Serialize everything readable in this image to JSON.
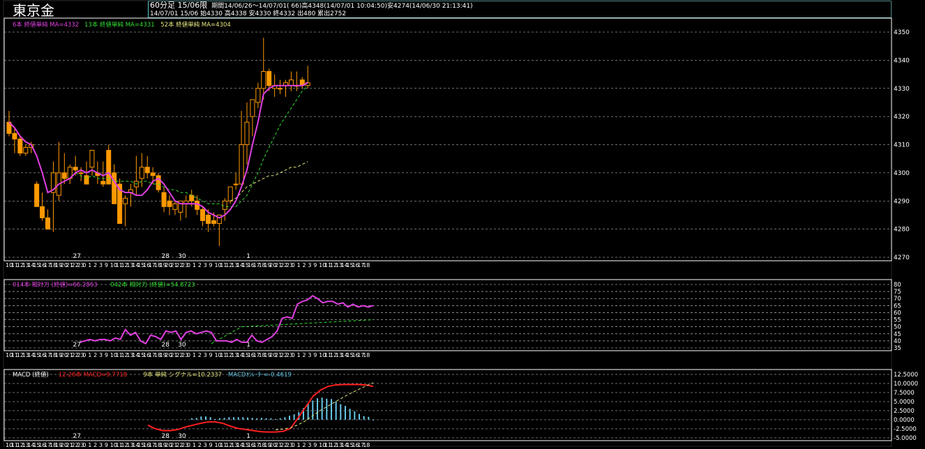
{
  "title": "東京金",
  "info": {
    "line1_contract": "60分足 15/06限",
    "line1_stats": "期間14/06/26〜14/07/01( 66)高4348(14/07/01 10:04:50)安4274(14/06/30 21:13:41)",
    "line2": "14/07/01 15/06 始4330 高4338 安4330 終4332 出480 累出2752"
  },
  "colors": {
    "up": "#000000",
    "down": "#ff9900",
    "candle_outline": "#ff9900",
    "ma6": "#e040e0",
    "ma13": "#33dd33",
    "ma52": "#e8e880",
    "rsi14": "#e040e0",
    "rsi42": "#33dd33",
    "macd": "#ff2020",
    "signal": "#e8e880",
    "histogram": "#66c8e8",
    "grid": "#ffffff",
    "border": "#ffffff"
  },
  "x_axis": {
    "hour_labels": [
      "10",
      "11",
      "12",
      "13",
      "14",
      "15",
      "16",
      "17",
      "18",
      "19",
      "20",
      "21",
      "22",
      "23",
      "0",
      "1",
      "2",
      "3",
      "9",
      "10",
      "11",
      "12",
      "13",
      "14",
      "15",
      "16",
      "17",
      "18",
      "19",
      "20",
      "21",
      "22",
      "23",
      "0",
      "1",
      "2",
      "3",
      "9",
      "10",
      "11",
      "12",
      "13",
      "14",
      "15",
      "16",
      "17",
      "18",
      "19",
      "20",
      "21",
      "22",
      "23",
      "0",
      "1",
      "2",
      "3",
      "9",
      "10",
      "11",
      "12",
      "13",
      "14",
      "15",
      "16",
      "17",
      "18"
    ],
    "hour_text": "101112345678902122230123910112345678902122230123910112345678902122230123910112345678902 1",
    "date_labels": [
      {
        "text": "27",
        "index": 11
      },
      {
        "text": "28",
        "index": 27
      },
      {
        "text": "30",
        "index": 30
      },
      {
        "text": "1",
        "index": 42
      }
    ]
  },
  "chart_data": [
    {
      "type": "candlestick",
      "title": "東京金 60分足 15/06限",
      "legend": [
        {
          "label": "6本 終値単純 MA=4332",
          "color": "#e040e0"
        },
        {
          "label": "13本 終値単純 MA=4331",
          "color": "#33dd33"
        },
        {
          "label": "52本 終値単純 MA=4304",
          "color": "#e8e880"
        }
      ],
      "ylim": [
        4270,
        4350
      ],
      "yticks": [
        4270,
        4280,
        4290,
        4300,
        4310,
        4320,
        4330,
        4340,
        4350
      ],
      "series": [
        {
          "name": "candles",
          "open": [
            4318,
            4314,
            4312,
            4307,
            4309,
            4296,
            4288,
            4284,
            4293,
            4292,
            4300,
            4298,
            4302,
            4300,
            4299,
            4302,
            4300,
            4297,
            4308,
            4300,
            4296,
            4289,
            4293,
            4295,
            4298,
            4302,
            4300,
            4299,
            4293,
            4290,
            4287,
            4286,
            4289,
            4292,
            4290,
            4287,
            4285,
            4283,
            4282,
            4287,
            4290,
            4296,
            4296,
            4310,
            4320,
            4325,
            4330,
            4336,
            4330,
            4330,
            4331,
            4331,
            4331,
            4333,
            4331
          ],
          "high": [
            4322,
            4316,
            4313,
            4310,
            4311,
            4297,
            4293,
            4287,
            4304,
            4311,
            4307,
            4303,
            4306,
            4302,
            4304,
            4305,
            4304,
            4304,
            4310,
            4303,
            4298,
            4292,
            4296,
            4306,
            4307,
            4306,
            4302,
            4300,
            4295,
            4292,
            4290,
            4290,
            4292,
            4294,
            4292,
            4288,
            4287,
            4286,
            4284,
            4291,
            4295,
            4300,
            4322,
            4325,
            4325,
            4332,
            4348,
            4337,
            4335,
            4333,
            4333,
            4336,
            4336,
            4334,
            4338
          ],
          "low": [
            4313,
            4307,
            4306,
            4306,
            4307,
            4288,
            4283,
            4280,
            4279,
            4290,
            4296,
            4296,
            4299,
            4297,
            4297,
            4299,
            4296,
            4295,
            4296,
            4292,
            4288,
            4281,
            4288,
            4292,
            4295,
            4298,
            4296,
            4293,
            4286,
            4285,
            4285,
            4283,
            4284,
            4288,
            4285,
            4281,
            4279,
            4281,
            4274,
            4283,
            4289,
            4294,
            4296,
            4303,
            4313,
            4323,
            4326,
            4329,
            4327,
            4328,
            4327,
            4329,
            4329,
            4330,
            4330
          ],
          "close": [
            4314,
            4312,
            4307,
            4309,
            4310,
            4288,
            4284,
            4280,
            4300,
            4300,
            4298,
            4302,
            4301,
            4300,
            4296,
            4308,
            4299,
            4296,
            4296,
            4289,
            4282,
            4291,
            4294,
            4297,
            4302,
            4300,
            4299,
            4294,
            4288,
            4288,
            4289,
            4290,
            4290,
            4290,
            4287,
            4283,
            4282,
            4282,
            4285,
            4290,
            4295,
            4296,
            4310,
            4318,
            4326,
            4330,
            4336,
            4331,
            4331,
            4330,
            4332,
            4333,
            4331,
            4331,
            4332
          ]
        },
        {
          "name": "6本 終値単純",
          "values": [
            4318,
            4316,
            4313,
            4311,
            4310,
            4306,
            4300,
            4293,
            4294,
            4296,
            4297,
            4298,
            4300,
            4301,
            4300,
            4301,
            4300,
            4299,
            4300,
            4297,
            4294,
            4293,
            4293,
            4292,
            4292,
            4294,
            4297,
            4298,
            4296,
            4293,
            4290,
            4289,
            4289,
            4289,
            4289,
            4288,
            4286,
            4285,
            4284,
            4285,
            4287,
            4290,
            4295,
            4301,
            4310,
            4318,
            4328,
            4330,
            4331,
            4331,
            4331,
            4331,
            4331,
            4331,
            4332
          ]
        },
        {
          "name": "13本 終値単純",
          "values": [
            null,
            null,
            null,
            null,
            null,
            null,
            null,
            null,
            null,
            null,
            null,
            null,
            4300,
            4299,
            4298,
            4299,
            4298,
            4298,
            4298,
            4297,
            4297,
            4297,
            4297,
            4296,
            4297,
            4297,
            4296,
            4296,
            4295,
            4294,
            4294,
            4293,
            4293,
            4292,
            4291,
            4290,
            4289,
            4289,
            4289,
            4288,
            4288,
            4288,
            4290,
            4292,
            4296,
            4300,
            4305,
            4309,
            4313,
            4317,
            4320,
            4323,
            4326,
            4329,
            4331
          ]
        },
        {
          "name": "52本 終値単純",
          "values": [
            null,
            null,
            null,
            null,
            null,
            null,
            null,
            null,
            null,
            null,
            null,
            null,
            null,
            null,
            null,
            null,
            null,
            null,
            null,
            null,
            null,
            null,
            null,
            null,
            null,
            null,
            null,
            null,
            null,
            null,
            null,
            null,
            null,
            null,
            null,
            null,
            null,
            null,
            null,
            null,
            4290,
            4291,
            4293,
            4295,
            4296,
            4297,
            4298,
            4299,
            4299,
            4300,
            4301,
            4302,
            4302,
            4303,
            4304
          ]
        }
      ]
    },
    {
      "type": "line",
      "title": "相対力",
      "legend": [
        {
          "label": "014本 相対力 (終値)=66.2863",
          "color": "#e040e0"
        },
        {
          "label": "042本 相対力 (終値)=54.8723",
          "color": "#33dd33"
        }
      ],
      "ylim": [
        35,
        80
      ],
      "yticks": [
        35,
        40,
        45,
        50,
        55,
        60,
        65,
        70,
        75,
        80
      ],
      "series": [
        {
          "name": "014本 相対力",
          "values": [
            null,
            null,
            null,
            null,
            null,
            null,
            null,
            null,
            null,
            null,
            null,
            null,
            null,
            null,
            39,
            40,
            41,
            40,
            41,
            41,
            40,
            42,
            41,
            48,
            44,
            46,
            40,
            38,
            44,
            43,
            41,
            47,
            46,
            47,
            41,
            46,
            47,
            45,
            46,
            47,
            46,
            40,
            40,
            40,
            39,
            41,
            39,
            39,
            44,
            40,
            39,
            41,
            43,
            47,
            56,
            57,
            56,
            66,
            68,
            69,
            72,
            70,
            67,
            68,
            68,
            66,
            67,
            64,
            66,
            64,
            65,
            64,
            65
          ]
        },
        {
          "name": "042本 相対力",
          "values": [
            null,
            null,
            null,
            null,
            null,
            null,
            null,
            null,
            null,
            null,
            null,
            null,
            null,
            null,
            null,
            null,
            null,
            null,
            null,
            null,
            null,
            null,
            null,
            null,
            null,
            null,
            null,
            null,
            null,
            null,
            null,
            null,
            null,
            null,
            null,
            null,
            null,
            null,
            null,
            null,
            null,
            null,
            null,
            null,
            null,
            null,
            null,
            null,
            null,
            null,
            null,
            null,
            null,
            null,
            null,
            null,
            null,
            null,
            null,
            null,
            null,
            null,
            null,
            null,
            null,
            null,
            null,
            null,
            null,
            null,
            null,
            null,
            null
          ]
        }
      ]
    },
    {
      "type": "line",
      "title": "MACD (終値)",
      "legend": [
        {
          "label": "MACD (終値)",
          "color": "#ffffff"
        },
        {
          "label": "12-26本 MACD=9.7718",
          "color": "#ff2020"
        },
        {
          "label": "9本 単純 シグナル=10.2337",
          "color": "#e8e880"
        },
        {
          "label": "MACDｵｼﾚｰﾀｰ=-0.4619",
          "color": "#66c8e8"
        }
      ],
      "ylim": [
        -5,
        12.5
      ],
      "yticks": [
        -5,
        -2.5,
        0,
        2.5,
        5,
        7.5,
        10,
        12.5
      ],
      "series": [
        {
          "name": "MACD",
          "values": [
            -1.5,
            -2.5,
            -3.0,
            -3.0,
            -2.7,
            -2.0,
            -1.5,
            -1.0,
            -0.6,
            -0.6,
            -1.0,
            -1.8,
            -2.4,
            -2.7,
            -3.0,
            -3.3,
            -3.4,
            -3.4,
            -3.2,
            -2.4,
            0.5,
            3.5,
            6.5,
            8.2,
            9.2,
            9.6,
            9.7,
            9.7,
            9.7,
            9.6,
            9.2
          ]
        },
        {
          "name": "シグナル",
          "values": [
            null,
            null,
            null,
            null,
            null,
            null,
            null,
            null,
            null,
            null,
            null,
            null,
            null,
            null,
            null,
            null,
            null,
            -2.8,
            -2.6,
            -2.2,
            -1.4,
            -0.3,
            1.2,
            2.6,
            3.8,
            5.0,
            6.2,
            7.3,
            8.3,
            9.3,
            10.2
          ]
        },
        {
          "name": "MACDｵｼﾚｰﾀｰ",
          "values": [
            0.4,
            0.5,
            0.9,
            0.9,
            0.7,
            0.2,
            0.4,
            0.5,
            0.7,
            0.7,
            0.7,
            0.7,
            0.6,
            0.5,
            0.4,
            0.5,
            0.4,
            0.4,
            0.2,
            0.4,
            0.7,
            1.1,
            1.5,
            2.1,
            3.2,
            4.4,
            5.3,
            5.9,
            6.1,
            5.8,
            5.7,
            5.0,
            4.3,
            3.8,
            3.0,
            2.3,
            1.6,
            1.0,
            0.8,
            -0.2
          ]
        }
      ]
    }
  ]
}
